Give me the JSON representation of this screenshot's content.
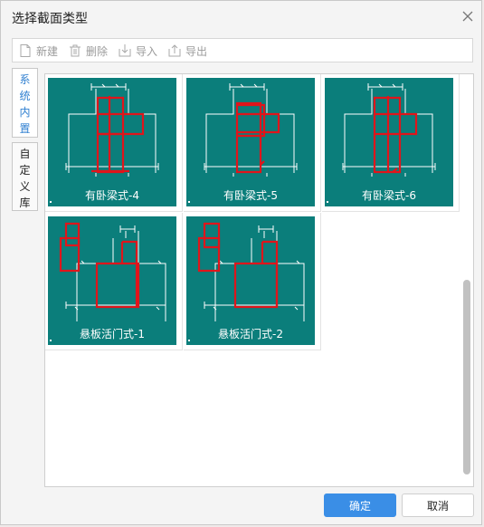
{
  "dialog": {
    "title": "选择截面类型"
  },
  "toolbar": {
    "new_label": "新建",
    "delete_label": "删除",
    "import_label": "导入",
    "export_label": "导出"
  },
  "sidebar": {
    "tab_builtin": [
      "系",
      "统",
      "内",
      "置"
    ],
    "tab_custom": [
      "自",
      "定",
      "义",
      "库"
    ]
  },
  "sections": [
    {
      "label": "有卧梁式-4"
    },
    {
      "label": "有卧梁式-5"
    },
    {
      "label": "有卧梁式-6"
    },
    {
      "label": "悬板活门式-1"
    },
    {
      "label": "悬板活门式-2"
    }
  ],
  "footer": {
    "ok_label": "确定",
    "cancel_label": "取消"
  },
  "colors": {
    "thumb_bg": "#0b7e7b",
    "rebar": "#e0151b",
    "primary": "#3a8ee6"
  }
}
